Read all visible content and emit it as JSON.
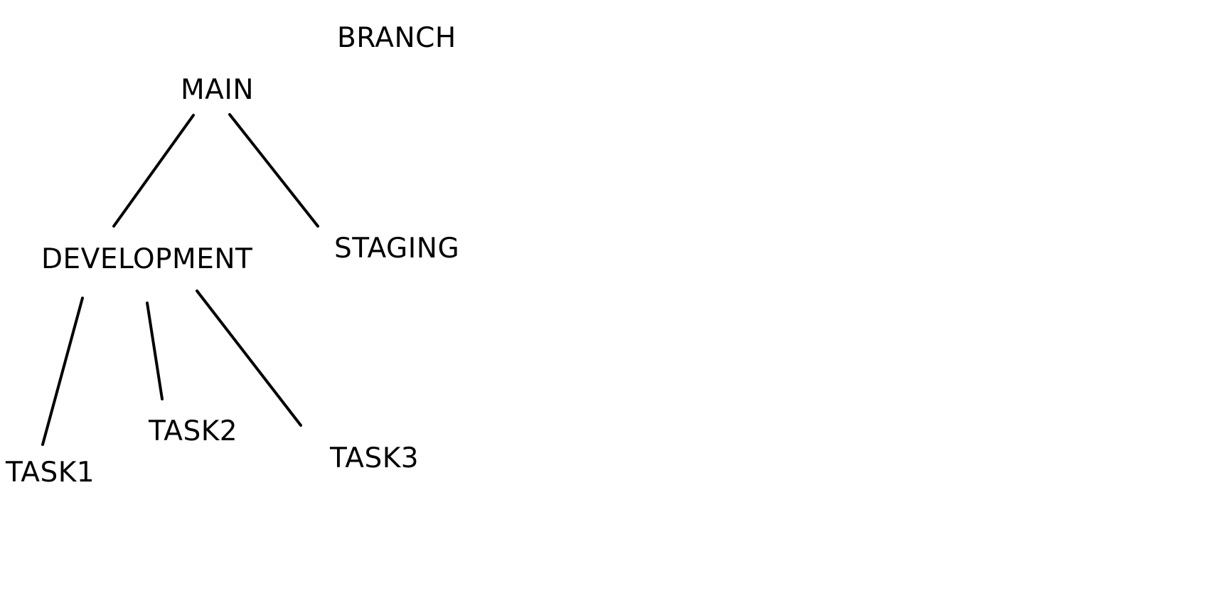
{
  "diagram": {
    "title": "BRANCH",
    "nodes": {
      "main": "MAIN",
      "development": "DEVELOPMENT",
      "staging": "STAGING",
      "task1": "TASK1",
      "task2": "TASK2",
      "task3": "TASK3"
    },
    "edges": [
      {
        "from": "MAIN",
        "to": "DEVELOPMENT"
      },
      {
        "from": "MAIN",
        "to": "STAGING"
      },
      {
        "from": "DEVELOPMENT",
        "to": "TASK1"
      },
      {
        "from": "DEVELOPMENT",
        "to": "TASK2"
      },
      {
        "from": "DEVELOPMENT",
        "to": "TASK3"
      }
    ],
    "line_color": "#000000",
    "background_color": "#ffffff"
  }
}
